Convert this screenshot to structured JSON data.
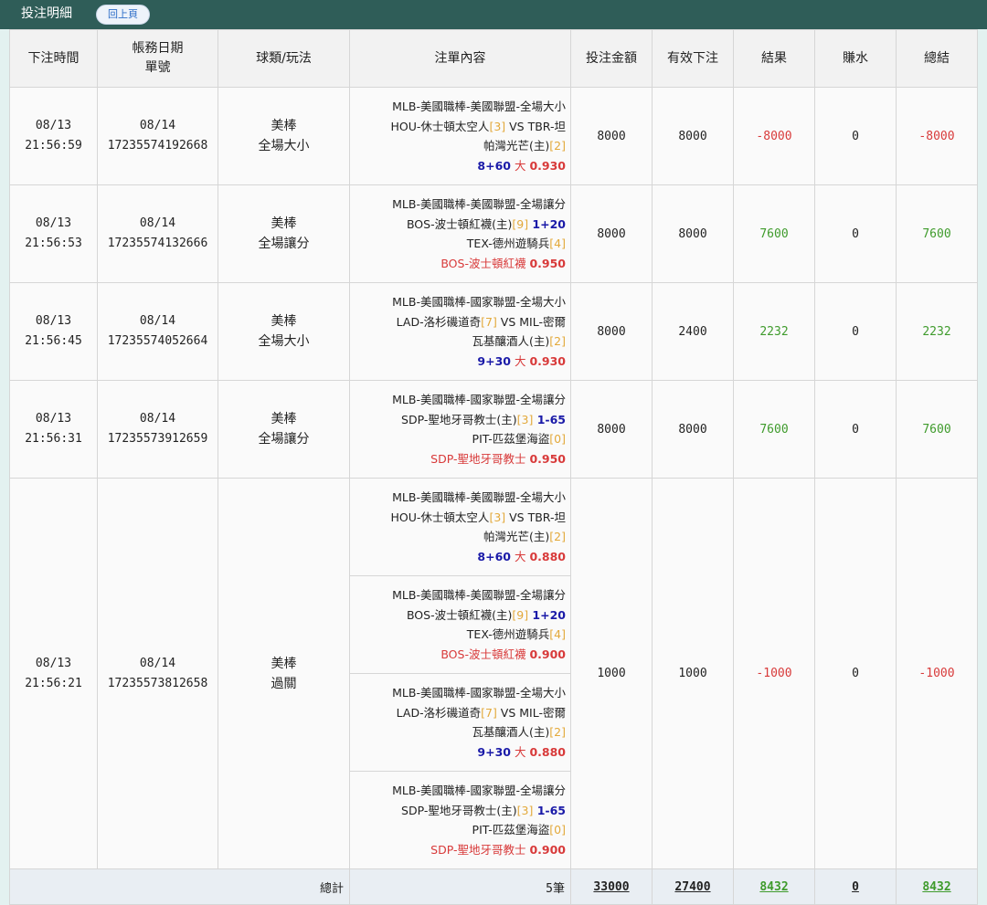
{
  "header": {
    "title": "投注明細",
    "back_label": "回上頁"
  },
  "columns": [
    "下注時間",
    "帳務日期",
    "單號",
    "球類/玩法",
    "注單內容",
    "投注金額",
    "有效下注",
    "結果",
    "賺水",
    "總結"
  ],
  "rows": [
    {
      "bet_date": "08/13",
      "bet_time": "21:56:59",
      "account_date": "08/14",
      "ticket_no": "17235574192668",
      "sport": "美棒",
      "play": "全場大小",
      "legs": [
        {
          "line1": "MLB-美國職棒-美國聯盟-全場大小",
          "line2a": "HOU-休士頓太空人",
          "line2a_rank": "[3]",
          "line2b": " VS TBR-坦",
          "line3": "帕灣光芒(主)",
          "line3_rank": "[2]",
          "handicap": "8+60",
          "pick": " 大 ",
          "odds": "0.930"
        }
      ],
      "amount": "8000",
      "valid": "8000",
      "result": "-8000",
      "rebate": "0",
      "total": "-8000"
    },
    {
      "bet_date": "08/13",
      "bet_time": "21:56:53",
      "account_date": "08/14",
      "ticket_no": "17235574132666",
      "sport": "美棒",
      "play": "全場讓分",
      "legs": [
        {
          "line1": "MLB-美國職棒-美國聯盟-全場讓分",
          "line2a": "BOS-波士頓紅襪(主)",
          "line2a_rank": "[9]",
          "handicap": " 1+20",
          "line3": "TEX-德州遊騎兵",
          "line3_rank": "[4]",
          "pick": "BOS-波士頓紅襪 ",
          "odds": "0.950"
        }
      ],
      "amount": "8000",
      "valid": "8000",
      "result": "7600",
      "rebate": "0",
      "total": "7600"
    },
    {
      "bet_date": "08/13",
      "bet_time": "21:56:45",
      "account_date": "08/14",
      "ticket_no": "17235574052664",
      "sport": "美棒",
      "play": "全場大小",
      "legs": [
        {
          "line1": "MLB-美國職棒-國家聯盟-全場大小",
          "line2a": "LAD-洛杉磯道奇",
          "line2a_rank": "[7]",
          "line2b": " VS MIL-密爾",
          "line3": "瓦基釀酒人(主)",
          "line3_rank": "[2]",
          "handicap": "9+30",
          "pick": " 大 ",
          "odds": "0.930"
        }
      ],
      "amount": "8000",
      "valid": "2400",
      "result": "2232",
      "rebate": "0",
      "total": "2232"
    },
    {
      "bet_date": "08/13",
      "bet_time": "21:56:31",
      "account_date": "08/14",
      "ticket_no": "17235573912659",
      "sport": "美棒",
      "play": "全場讓分",
      "legs": [
        {
          "line1": "MLB-美國職棒-國家聯盟-全場讓分",
          "line2a": "SDP-聖地牙哥教士(主)",
          "line2a_rank": "[3]",
          "handicap": " 1-65",
          "line3": "PIT-匹茲堡海盜",
          "line3_rank": "[0]",
          "pick": "SDP-聖地牙哥教士 ",
          "odds": "0.950"
        }
      ],
      "amount": "8000",
      "valid": "8000",
      "result": "7600",
      "rebate": "0",
      "total": "7600"
    },
    {
      "bet_date": "08/13",
      "bet_time": "21:56:21",
      "account_date": "08/14",
      "ticket_no": "17235573812658",
      "sport": "美棒",
      "play": "過關",
      "legs": [
        {
          "line1": "MLB-美國職棒-美國聯盟-全場大小",
          "line2a": "HOU-休士頓太空人",
          "line2a_rank": "[3]",
          "line2b": " VS TBR-坦",
          "line3": "帕灣光芒(主)",
          "line3_rank": "[2]",
          "handicap": "8+60",
          "pick": " 大 ",
          "odds": "0.880"
        },
        {
          "line1": "MLB-美國職棒-美國聯盟-全場讓分",
          "line2a": "BOS-波士頓紅襪(主)",
          "line2a_rank": "[9]",
          "handicap": " 1+20",
          "line3": "TEX-德州遊騎兵",
          "line3_rank": "[4]",
          "pick": "BOS-波士頓紅襪 ",
          "odds": "0.900"
        },
        {
          "line1": "MLB-美國職棒-國家聯盟-全場大小",
          "line2a": "LAD-洛杉磯道奇",
          "line2a_rank": "[7]",
          "line2b": " VS MIL-密爾",
          "line3": "瓦基釀酒人(主)",
          "line3_rank": "[2]",
          "handicap": "9+30",
          "pick": " 大 ",
          "odds": "0.880"
        },
        {
          "line1": "MLB-美國職棒-國家聯盟-全場讓分",
          "line2a": "SDP-聖地牙哥教士(主)",
          "line2a_rank": "[3]",
          "handicap": " 1-65",
          "line3": "PIT-匹茲堡海盜",
          "line3_rank": "[0]",
          "pick": "SDP-聖地牙哥教士 ",
          "odds": "0.900"
        }
      ],
      "amount": "1000",
      "valid": "1000",
      "result": "-1000",
      "rebate": "0",
      "total": "-1000"
    }
  ],
  "footer": {
    "label": "總計",
    "count": "5筆",
    "amount": "33000",
    "valid": "27400",
    "result": "8432",
    "rebate": "0",
    "total": "8432"
  }
}
